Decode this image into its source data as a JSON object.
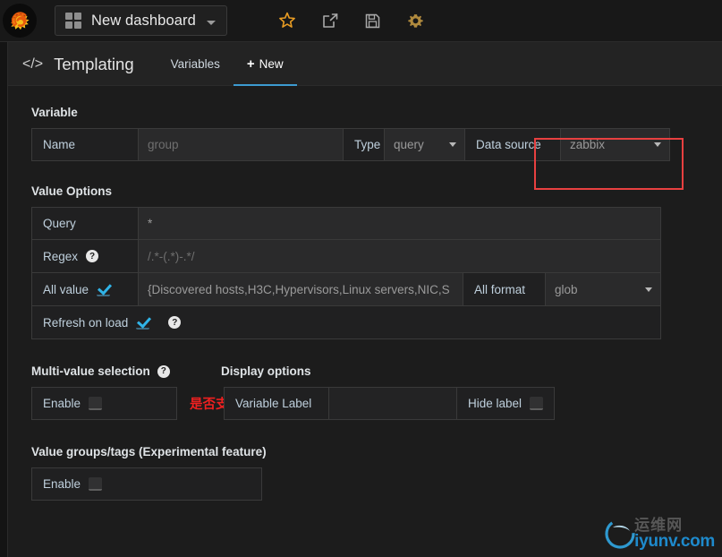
{
  "navbar": {
    "logo_icon": "grafana-logo-icon",
    "dashboard_title": "New dashboard",
    "dashboard_grid_icon": "grid-icon",
    "dashboard_caret_icon": "chevron-down-icon",
    "actions": [
      {
        "name": "star-icon",
        "label": "Star dashboard"
      },
      {
        "name": "share-icon",
        "label": "Share dashboard"
      },
      {
        "name": "save-icon",
        "label": "Save dashboard"
      },
      {
        "name": "gear-icon",
        "label": "Dashboard settings"
      }
    ]
  },
  "tabs": {
    "heading": "Templating",
    "heading_icon": "code-icon",
    "items": [
      {
        "label": "Variables",
        "active": false
      },
      {
        "label": "New",
        "active": true,
        "prefix": "+"
      }
    ]
  },
  "variable_section": {
    "title": "Variable",
    "name_label": "Name",
    "name_value": "group",
    "type_label": "Type",
    "type_value": "query",
    "datasource_label": "Data source",
    "datasource_value": "zabbix"
  },
  "value_options": {
    "title": "Value Options",
    "query_label": "Query",
    "query_value": "*",
    "regex_label": "Regex",
    "regex_placeholder": "/.*-(.*)-.*/",
    "all_value_label": "All value",
    "all_value_checked": true,
    "all_value_text": "{Discovered hosts,H3C,Hypervisors,Linux servers,NIC,S",
    "all_format_label": "All format",
    "all_format_value": "glob",
    "refresh_label": "Refresh on load",
    "refresh_checked": true,
    "help_glyph": "?"
  },
  "multi_value": {
    "title": "Multi-value selection",
    "enable_label": "Enable",
    "enable_checked": false,
    "annotation_cn": "是否支持多选"
  },
  "display_options": {
    "title": "Display options",
    "variable_label_label": "Variable Label",
    "variable_label_value": "",
    "hide_label_label": "Hide label",
    "hide_label_checked": false
  },
  "value_groups": {
    "title": "Value groups/tags (Experimental feature)",
    "enable_label": "Enable",
    "enable_checked": false
  },
  "watermark": {
    "cn": "运维网",
    "en": "iyunv.com",
    "accent": "#1f8fd4"
  },
  "colors": {
    "highlight": "#e84040",
    "tab_active": "#3d9bd1",
    "checkbox_on": "#30b4e8",
    "annotation": "#ef2020"
  }
}
